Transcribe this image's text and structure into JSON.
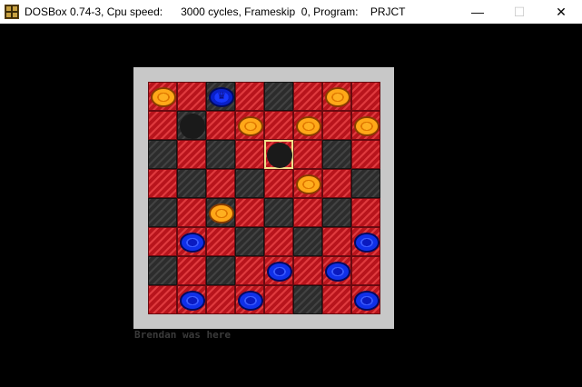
{
  "window": {
    "title": "DOSBox 0.74-3, Cpu speed:      3000 cycles, Frameskip  0, Program:    PRJCT",
    "icon": "dosbox-icon",
    "minimize_glyph": "—",
    "maximize_glyph": "☐",
    "close_glyph": "✕"
  },
  "game": {
    "credit": "Brendan was here",
    "board": [
      [
        "orange",
        "",
        "blue-king",
        "",
        "",
        "",
        "orange",
        ""
      ],
      [
        "",
        "hole",
        "",
        "orange",
        "",
        "orange",
        "",
        "orange"
      ],
      [
        "",
        "",
        "",
        "",
        "hole-selected",
        "",
        "",
        ""
      ],
      [
        "",
        "",
        "",
        "",
        "",
        "orange",
        "",
        ""
      ],
      [
        "",
        "",
        "orange",
        "",
        "",
        "",
        "",
        ""
      ],
      [
        "",
        "blue",
        "",
        "",
        "",
        "",
        "",
        "blue"
      ],
      [
        "",
        "",
        "",
        "",
        "blue",
        "",
        "blue",
        ""
      ],
      [
        "",
        "blue",
        "",
        "blue",
        "",
        "",
        "",
        "blue"
      ]
    ],
    "squares": [
      [
        "red",
        "red",
        "dark",
        "red",
        "dark",
        "red",
        "red",
        "red"
      ],
      [
        "red",
        "dark",
        "red",
        "red",
        "red",
        "red",
        "red",
        "red"
      ],
      [
        "dark",
        "red",
        "dark",
        "red",
        "red",
        "red",
        "dark",
        "red"
      ],
      [
        "red",
        "dark",
        "red",
        "dark",
        "red",
        "red",
        "red",
        "dark"
      ],
      [
        "dark",
        "red",
        "dark",
        "red",
        "dark",
        "red",
        "dark",
        "red"
      ],
      [
        "red",
        "red",
        "red",
        "dark",
        "red",
        "dark",
        "red",
        "red"
      ],
      [
        "dark",
        "red",
        "dark",
        "red",
        "red",
        "red",
        "red",
        "red"
      ],
      [
        "red",
        "red",
        "red",
        "red",
        "red",
        "dark",
        "red",
        "red"
      ]
    ],
    "colors": {
      "red_square": "#b8141c",
      "dark_square": "#2c2c2c",
      "frame": "#c8c8c8",
      "orange_piece": "#ffa818",
      "blue_piece": "#1030e8",
      "selection": "#f0e08a"
    }
  }
}
